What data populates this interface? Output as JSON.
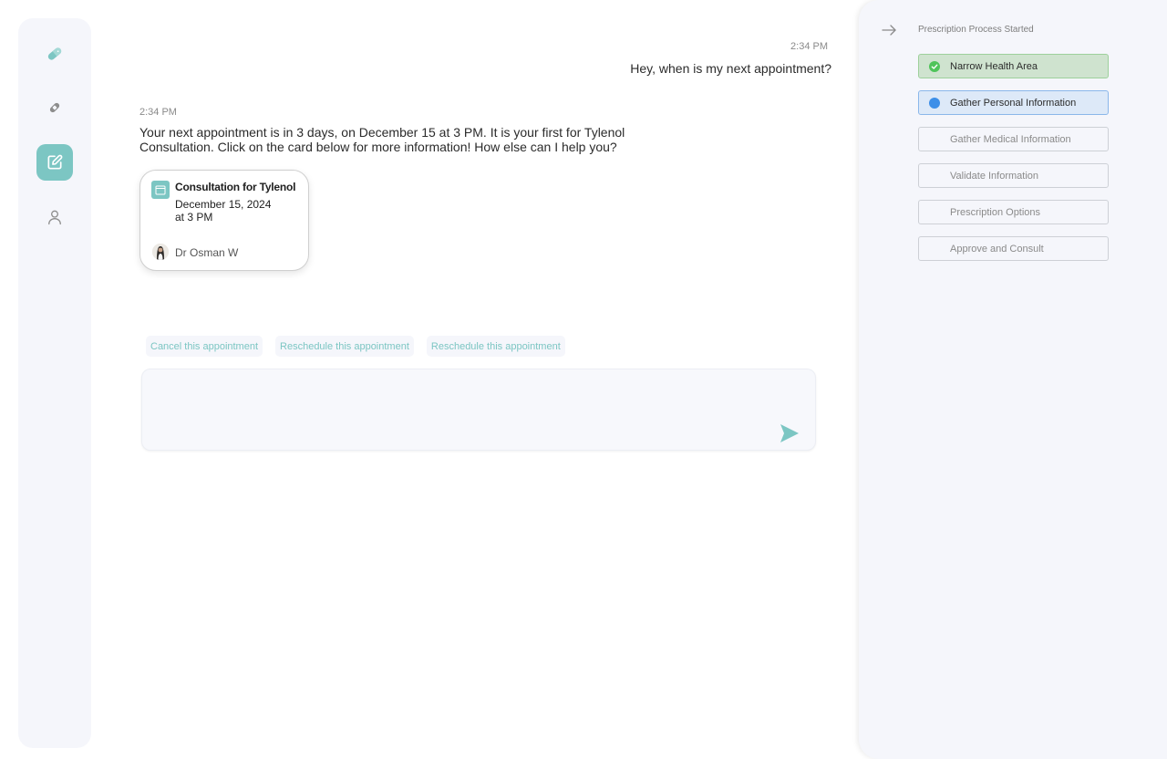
{
  "sidebar": {
    "items": [
      {
        "name": "pill-icon",
        "active": false
      },
      {
        "name": "bandage-icon",
        "active": false
      },
      {
        "name": "edit-icon",
        "active": true
      },
      {
        "name": "user-icon",
        "active": false
      }
    ]
  },
  "chat": {
    "messages": [
      {
        "role": "user",
        "time": "2:34 PM",
        "text": "Hey, when is my next appointment?"
      },
      {
        "role": "assistant",
        "time": "2:34 PM",
        "text": "Your next appointment is in 3 days, on December 15 at 3 PM. It is your first for Tylenol Consultation. Click on the card below for more information! How else can I help you?"
      }
    ],
    "appointment_card": {
      "icon": "calendar-icon",
      "title": "Consultation for Tylenol",
      "date": "December 15, 2024",
      "time": "at 3 PM",
      "doctor": "Dr Osman W"
    },
    "suggestions": [
      "Cancel this appointment",
      "Reschedule this appointment",
      "Reschedule this appointment"
    ],
    "composer": {
      "value": "",
      "placeholder": "",
      "send_icon": "send-icon"
    }
  },
  "process_panel": {
    "collapse_icon": "arrow-right-icon",
    "title": "Prescription Process Started",
    "steps": [
      {
        "label": "Narrow Health Area",
        "status": "done"
      },
      {
        "label": "Gather Personal Information",
        "status": "current"
      },
      {
        "label": "Gather Medical Information",
        "status": "pending"
      },
      {
        "label": "Validate Information",
        "status": "pending"
      },
      {
        "label": "Prescription Options",
        "status": "pending"
      },
      {
        "label": "Approve and Consult",
        "status": "pending"
      }
    ]
  },
  "colors": {
    "accent": "#7cc6c3",
    "done": "#4fc45a",
    "current": "#3d8fe8"
  }
}
